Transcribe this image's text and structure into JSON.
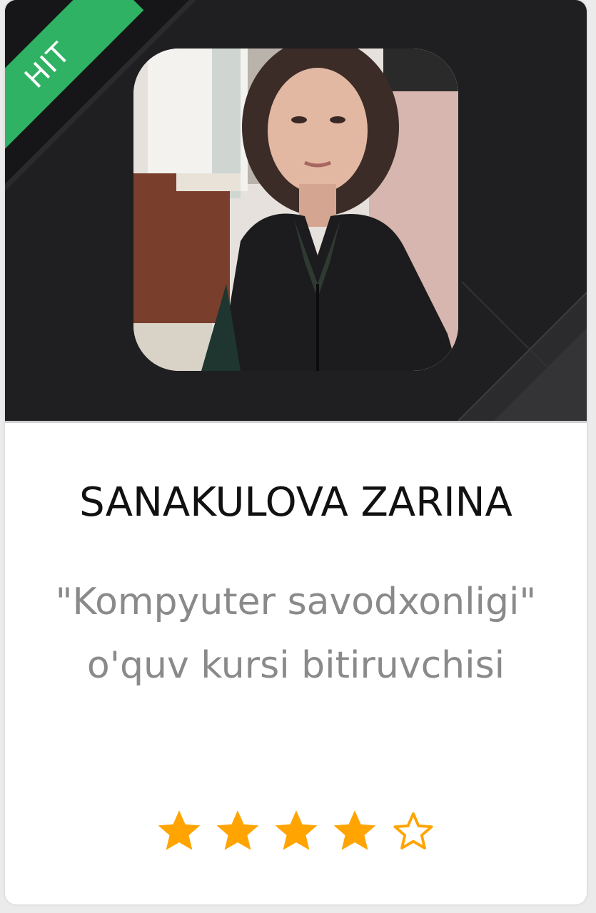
{
  "badge": {
    "label": "HIT",
    "color": "#2fb263"
  },
  "profile": {
    "name": "SANAKULOVA ZARINA",
    "description": "\"Kompyuter savodxonligi\" o'quv kursi bitiruvchisi"
  },
  "rating": {
    "value": 4,
    "max": 5,
    "star_color": "#ffa400"
  },
  "photo": {
    "alt": "portrait-photo"
  }
}
